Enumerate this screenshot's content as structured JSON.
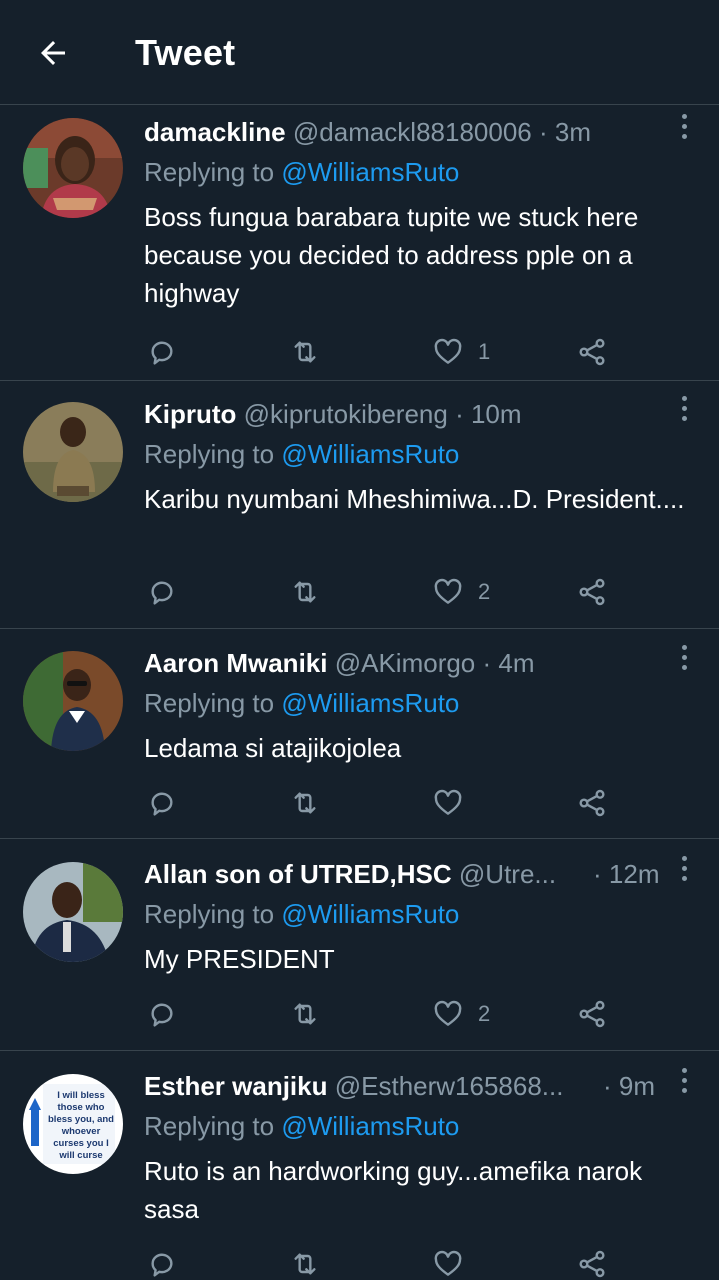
{
  "header": {
    "title": "Tweet"
  },
  "colors": {
    "background": "#15202b",
    "divider": "#38444d",
    "muted": "#8899a6",
    "link": "#1d9bf0"
  },
  "replying_label": "Replying to",
  "replies": [
    {
      "name": "damackline",
      "handle": "@damackl88180006",
      "time": "3m",
      "mention": "@WilliamsRuto",
      "text": "Boss fungua barabara tupite we stuck here because you decided to address pple on a highway",
      "likes": "1"
    },
    {
      "name": "Kipruto",
      "handle": "@kiprutokibereng",
      "time": "10m",
      "mention": "@WilliamsRuto",
      "text": "Karibu nyumbani Mheshimiwa...D. President....",
      "likes": "2"
    },
    {
      "name": "Aaron Mwaniki",
      "handle": "@AKimorgo",
      "time": "4m",
      "mention": "@WilliamsRuto",
      "text": "Ledama si atajikojolea",
      "likes": ""
    },
    {
      "name": "Allan son of UTRED,HSC",
      "handle": "@Utre...",
      "time": "12m",
      "mention": "@WilliamsRuto",
      "text": "My PRESIDENT",
      "likes": "2"
    },
    {
      "name": "Esther wanjiku",
      "handle": "@Estherw165868...",
      "time": "9m",
      "mention": "@WilliamsRuto",
      "text": "Ruto is an hardworking guy...amefika narok sasa",
      "likes": "",
      "avatar_text": "I will bless those who bless you, and whoever curses you I will curse"
    }
  ]
}
